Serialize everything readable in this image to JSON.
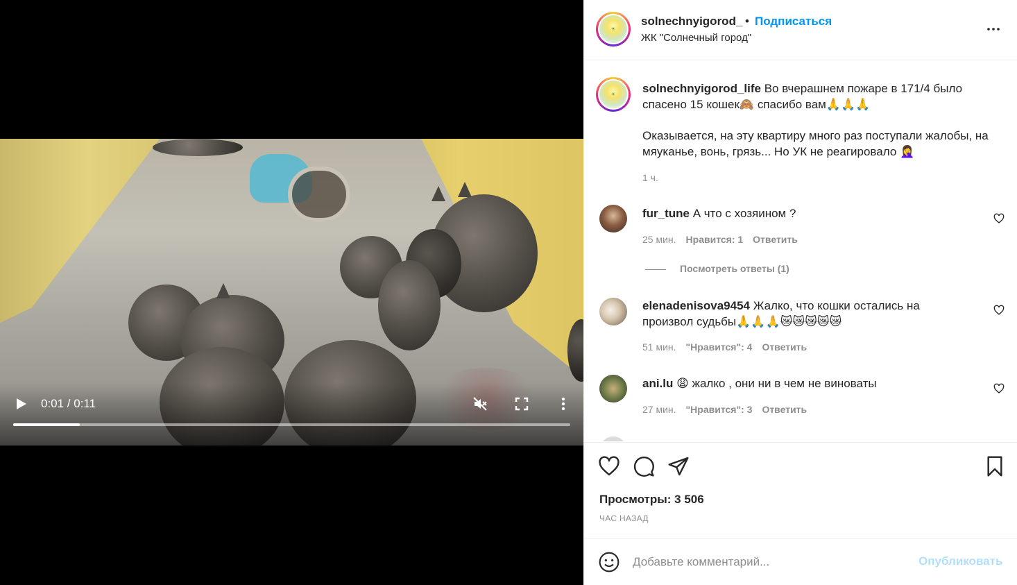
{
  "video": {
    "time": "0:01 / 0:11",
    "progress_fraction": 0.12
  },
  "header": {
    "username": "solnechnyigorod_",
    "dot": "•",
    "follow_label": "Подписаться",
    "location": "ЖК \"Солнечный город\""
  },
  "caption": {
    "username": "solnechnyigorod_life",
    "text1": " Во вчерашнем пожаре в 171/4 было спасено 15 кошек🙈 спасибо вам🙏🙏🙏",
    "text2": "Оказывается, на эту квартиру много раз поступали жалобы, на мяуканье, вонь, грязь... Но УК не реагировало 🤦‍♀️",
    "time": "1 ч."
  },
  "comments": [
    {
      "username": "fur_tune",
      "text": " А что с хозяином ?",
      "time": "25 мин.",
      "likes": "Нравится: 1",
      "reply": "Ответить",
      "view_replies": "Посмотреть ответы (1)"
    },
    {
      "username": "elenadenisova9454",
      "text": " Жалко, что кошки остались на произвол судьбы🙏🙏🙏😿😿😿😿😿",
      "time": "51 мин.",
      "likes": "\"Нравится\": 4",
      "reply": "Ответить"
    },
    {
      "username": "ani.lu",
      "text": " 😩 жалко , они ни в чем не виноваты",
      "time": "27 мин.",
      "likes": "\"Нравится\": 3",
      "reply": "Ответить"
    }
  ],
  "stats": {
    "views": "Просмотры: 3 506",
    "ago": "ЧАС НАЗАД"
  },
  "composer": {
    "placeholder": "Добавьте комментарий...",
    "publish_label": "Опубликовать"
  },
  "colors": {
    "link_blue": "#0095f6",
    "publish_disabled": "#b2dffc",
    "muted_text": "#8e8e8e",
    "border": "#efefef"
  }
}
